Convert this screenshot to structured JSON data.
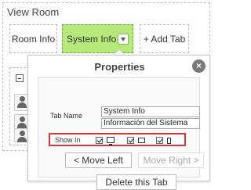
{
  "view_room": {
    "title": "View Room",
    "tabs": [
      {
        "label": "Room Info"
      },
      {
        "label": "System Info"
      },
      {
        "label": "+ Add Tab"
      }
    ]
  },
  "properties": {
    "title": "Properties",
    "close_glyph": "×",
    "tab_name_label": "Tab Name",
    "tab_name_values": [
      "System Info",
      "Información del Sistema"
    ],
    "show_in_label": "Show In",
    "show_in_devices": [
      {
        "icon": "desktop-icon",
        "checked": true
      },
      {
        "icon": "tablet-icon",
        "checked": true
      },
      {
        "icon": "phone-icon",
        "checked": true
      }
    ],
    "move_left_label": "< Move Left",
    "move_right_label": "Move Right >",
    "delete_label": "Delete this Tab"
  },
  "colors": {
    "active_tab_bg": "#b6e97a",
    "highlight_border": "#d9363b"
  }
}
